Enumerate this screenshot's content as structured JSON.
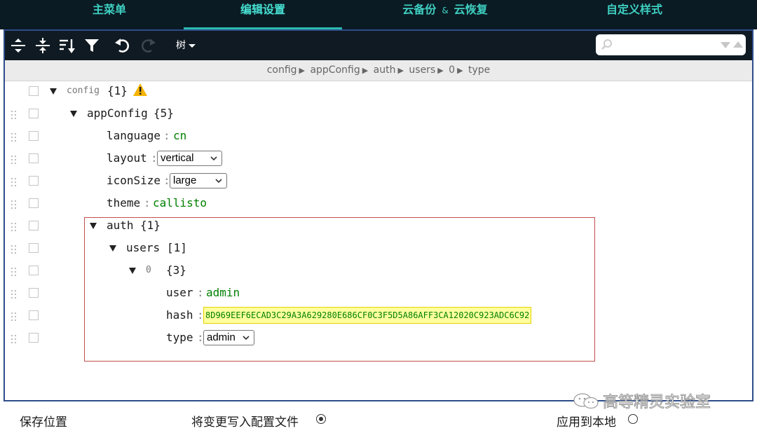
{
  "top_tabs": [
    {
      "label": "主菜单",
      "active": false
    },
    {
      "label": "编辑设置",
      "active": true
    },
    {
      "label_left": "云备份",
      "amp": "&",
      "label_right": "云恢复",
      "active": false
    },
    {
      "label": "自定义样式",
      "active": false
    }
  ],
  "menubar": {
    "buttons": [
      "expand-all-icon",
      "collapse-all-icon",
      "sort-icon",
      "filter-icon",
      "undo-icon",
      "redo-icon"
    ],
    "mode": "树",
    "search_value": ""
  },
  "breadcrumb": [
    "config",
    "appConfig",
    "auth",
    "users",
    "0",
    "type"
  ],
  "tree": {
    "root": {
      "key": "config",
      "count": "{1}"
    },
    "appConfig": {
      "key": "appConfig",
      "count": "{5}"
    },
    "language": {
      "key": "language",
      "value": "cn"
    },
    "layout": {
      "key": "layout",
      "value": "vertical"
    },
    "iconSize": {
      "key": "iconSize",
      "value": "large"
    },
    "theme": {
      "key": "theme",
      "value": "callisto"
    },
    "auth": {
      "key": "auth",
      "count": "{1}"
    },
    "users": {
      "key": "users",
      "count": "[1]"
    },
    "item0": {
      "key": "0",
      "count": "{3}"
    },
    "user": {
      "key": "user",
      "value": "admin"
    },
    "hash": {
      "key": "hash",
      "value": "8D969EEF6ECAD3C29A3A629280E686CF0C3F5D5A86AFF3CA12020C923ADC6C92"
    },
    "type": {
      "key": "type",
      "value": "admin"
    }
  },
  "bottombar": {
    "save_location": "保存位置",
    "write_config": "将变更写入配置文件",
    "write_config_selected": true,
    "apply_local": "应用到本地",
    "apply_local_selected": false
  },
  "watermark": "高等精灵实验室",
  "colors": {
    "nav_bg": "#0a1b24",
    "nav_text": "#3ecfc0",
    "frame": "#2e4d8a",
    "menubar_bg": "#0f1a22",
    "string_value": "#008000",
    "highlight_bg": "#ffff9e",
    "auth_box_border": "#c0504d",
    "warning": "#f5b400"
  }
}
